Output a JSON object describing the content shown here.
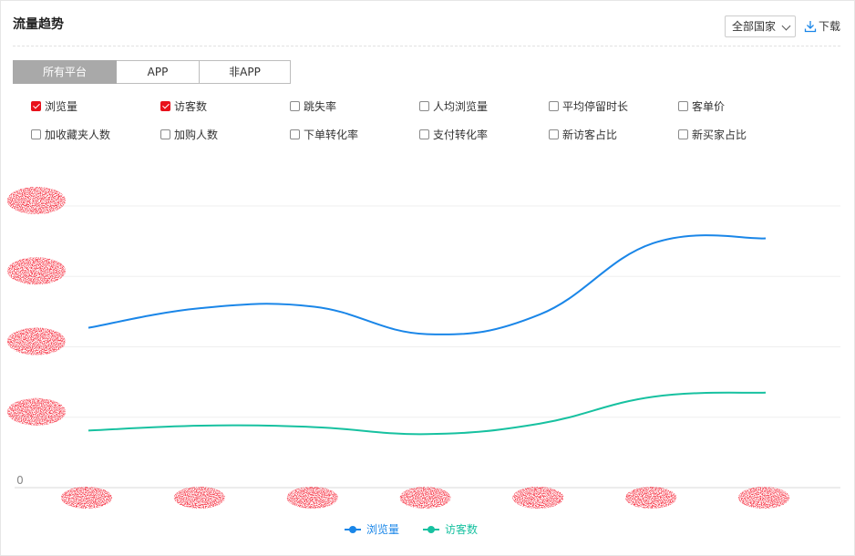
{
  "header": {
    "title": "流量趋势",
    "country_select": "全部国家",
    "download_label": "下载"
  },
  "platform_tabs": [
    {
      "label": "所有平台",
      "active": true
    },
    {
      "label": "APP",
      "active": false
    },
    {
      "label": "非APP",
      "active": false
    }
  ],
  "metrics": [
    {
      "label": "浏览量",
      "checked": true
    },
    {
      "label": "访客数",
      "checked": true
    },
    {
      "label": "跳失率",
      "checked": false
    },
    {
      "label": "人均浏览量",
      "checked": false
    },
    {
      "label": "平均停留时长",
      "checked": false
    },
    {
      "label": "客单价",
      "checked": false
    },
    {
      "label": "加收藏夹人数",
      "checked": false
    },
    {
      "label": "加购人数",
      "checked": false
    },
    {
      "label": "下单转化率",
      "checked": false
    },
    {
      "label": "支付转化率",
      "checked": false
    },
    {
      "label": "新访客占比",
      "checked": false
    },
    {
      "label": "新买家占比",
      "checked": false
    }
  ],
  "chart_data": {
    "type": "line",
    "title": "",
    "xlabel": "",
    "ylabel": "",
    "x": [
      "",
      "",
      "",
      "",
      "",
      "",
      ""
    ],
    "y_tick_labels": [
      "0",
      "",
      "",
      "",
      ""
    ],
    "ylim": [
      0,
      4
    ],
    "grid": true,
    "legend_position": "bottom-center",
    "series": [
      {
        "name": "浏览量",
        "color": "#1a86e8",
        "values": [
          2.27,
          2.55,
          2.57,
          2.18,
          2.46,
          3.47,
          3.54
        ]
      },
      {
        "name": "访客数",
        "color": "#17c1a0",
        "values": [
          0.81,
          0.88,
          0.86,
          0.76,
          0.91,
          1.29,
          1.35
        ]
      }
    ],
    "note_redacted": "y-axis and x-axis labels are obscured by red scribbles in the original"
  }
}
